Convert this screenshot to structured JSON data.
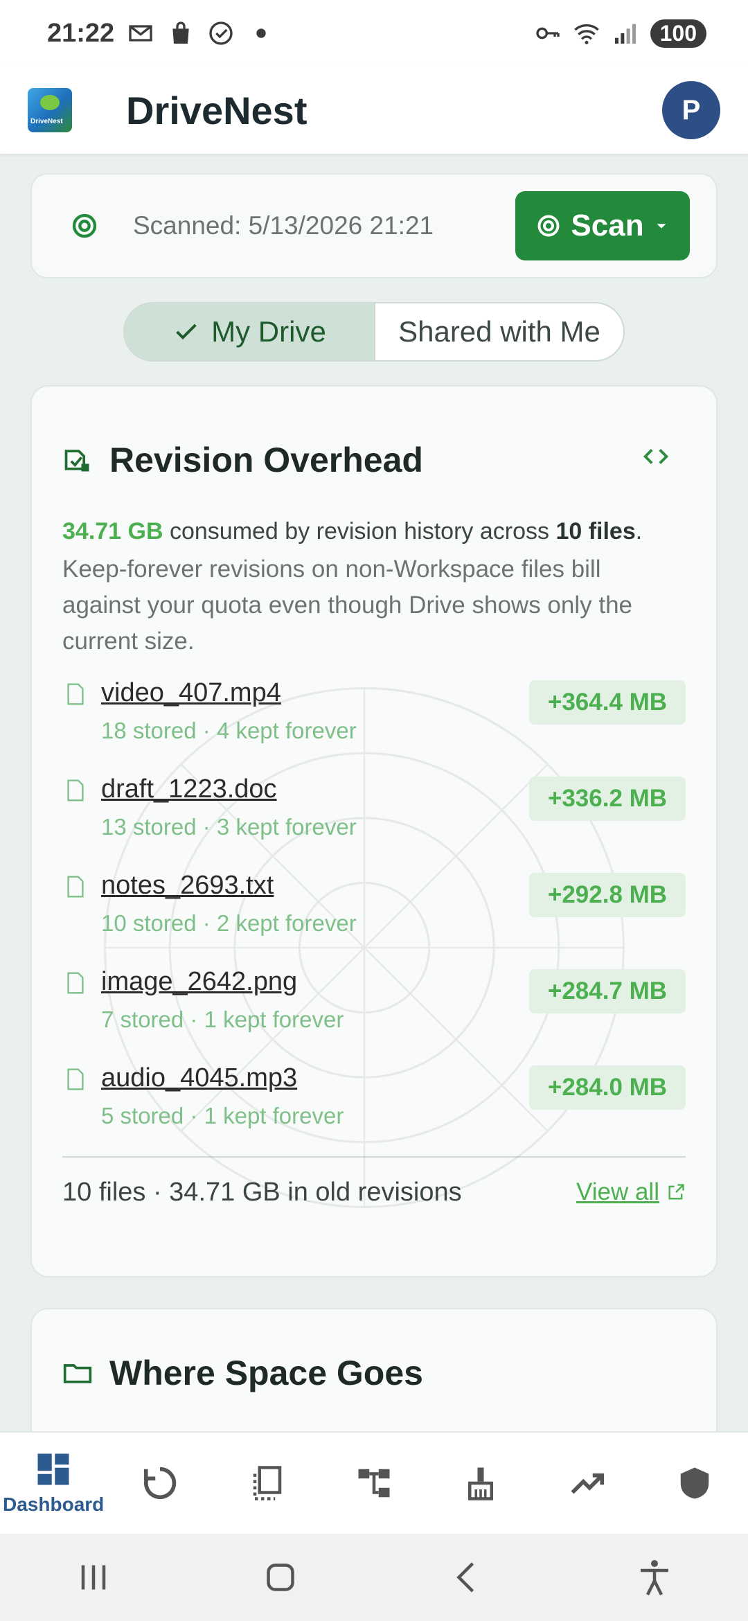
{
  "status_bar": {
    "time": "21:22",
    "battery": "100"
  },
  "app": {
    "title": "DriveNest",
    "logo_text": "DriveNest",
    "avatar_letter": "P"
  },
  "scan": {
    "text": "Scanned: 5/13/2026 21:21",
    "button_label": "Scan"
  },
  "tabs": {
    "my_drive": "My Drive",
    "shared": "Shared with Me"
  },
  "revision": {
    "title": "Revision Overhead",
    "summary_amount": "34.71 GB",
    "summary_mid": " consumed by revision history across ",
    "summary_count": "10 files",
    "summary_end": ".",
    "description": "Keep-forever revisions on non-Workspace files bill against your quota even though Drive shows only the current size.",
    "files": [
      {
        "name": "video_407.mp4",
        "meta": "18 stored · 4 kept forever",
        "size": "+364.4 MB"
      },
      {
        "name": "draft_1223.doc",
        "meta": "13 stored · 3 kept forever",
        "size": "+336.2 MB"
      },
      {
        "name": "notes_2693.txt",
        "meta": "10 stored · 2 kept forever",
        "size": "+292.8 MB"
      },
      {
        "name": "image_2642.png",
        "meta": "7 stored · 1 kept forever",
        "size": "+284.7 MB"
      },
      {
        "name": "audio_4045.mp3",
        "meta": "5 stored · 1 kept forever",
        "size": "+284.0 MB"
      }
    ],
    "footer_text": "10 files · 34.71 GB in old revisions",
    "view_all": "View all"
  },
  "space": {
    "title": "Where Space Goes"
  },
  "bottom_nav": {
    "dashboard_label": "Dashboard"
  },
  "colors": {
    "accent_green": "#228a3a",
    "highlight_green": "#4caf50",
    "nav_blue": "#2d5a8f"
  }
}
